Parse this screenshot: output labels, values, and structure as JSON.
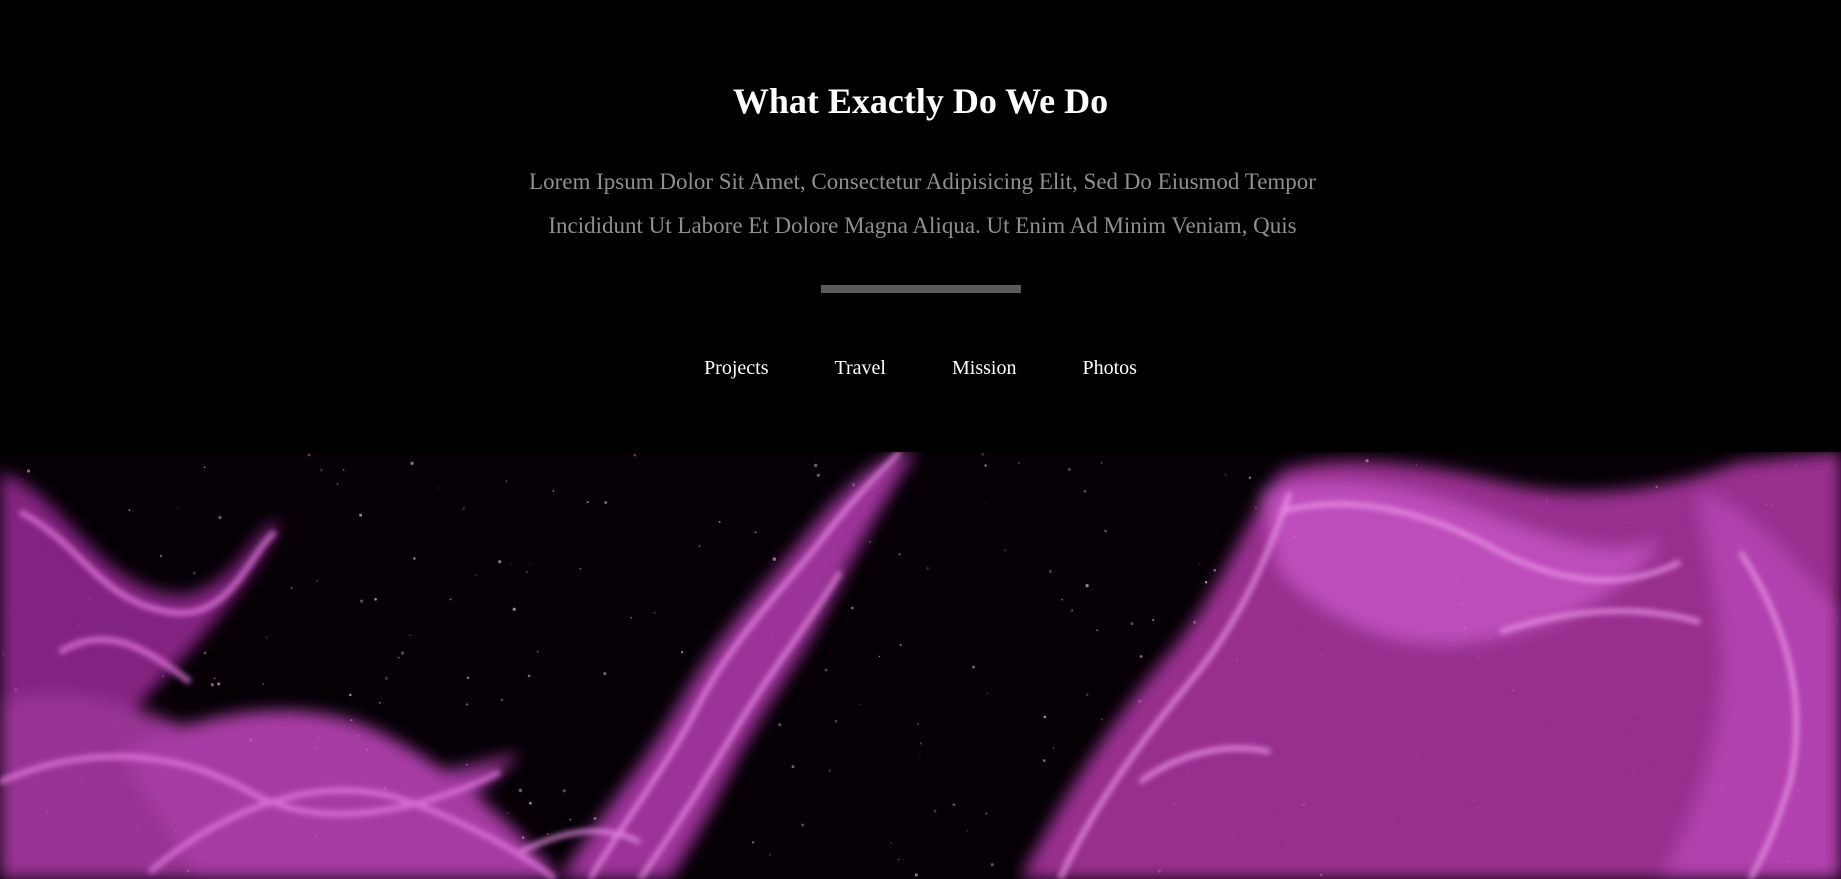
{
  "section": {
    "title": "What Exactly Do We Do",
    "description_lines": [
      "Lorem Ipsum Dolor Sit Amet, Consectetur Adipisicing Elit, Sed Do Eiusmod Tempor",
      "Incididunt Ut Labore Et Dolore Magna Aliqua. Ut Enim Ad Minim Veniam, Quis"
    ]
  },
  "tabs": [
    {
      "label": "Projects"
    },
    {
      "label": "Travel"
    },
    {
      "label": "Mission"
    },
    {
      "label": "Photos"
    }
  ],
  "colors": {
    "background": "#000000",
    "title": "#ffffff",
    "description": "#8f8f8f",
    "divider": "#5a5a5a",
    "smoke": "#d24fcf"
  },
  "hero_image": {
    "subject": "magenta smoke on black starfield"
  }
}
